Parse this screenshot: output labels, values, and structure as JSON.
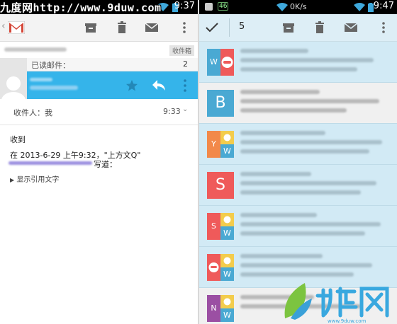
{
  "watermark": "九度网http://www.9duw.com",
  "left": {
    "status_time": "9:37",
    "folder_tag": "收件箱",
    "read_label": "已读邮件：",
    "read_count": "2",
    "to_label": "收件人：我",
    "time": "9:33",
    "body_greeting": "收到",
    "body_quote_line": "在 2013-6-29 上午9:32，\"上方文Q\"",
    "body_wrote": "写道：",
    "show_quoted": "显示引用文字"
  },
  "right": {
    "status_time": "9:47",
    "status_rate": "0K/s",
    "status_badge": "46",
    "selected_count": "5",
    "rows": [
      {
        "tile": "split-wf",
        "letters": [
          "W"
        ],
        "selected": true
      },
      {
        "tile": "single",
        "letters": [
          "B"
        ],
        "selected": false
      },
      {
        "tile": "quad",
        "letters": [
          "Y",
          "W"
        ],
        "selected": true
      },
      {
        "tile": "single",
        "letters": [
          "S"
        ],
        "selected": true
      },
      {
        "tile": "quad",
        "letters": [
          "S",
          "W"
        ],
        "selected": true
      },
      {
        "tile": "quad-face",
        "letters": [
          "W"
        ],
        "selected": true
      },
      {
        "tile": "quad",
        "letters": [
          "N",
          "W"
        ],
        "selected": false
      }
    ]
  },
  "logo_text": "www.9duw.com",
  "colors": {
    "accent_blue": "#35b4ea",
    "tile_blue": "#4aa9d3",
    "tile_orange": "#f2894a",
    "tile_red": "#ef5a5a",
    "tile_yellow": "#f3cc4c",
    "tile_purple": "#9b4fa3",
    "row_selected": "#d2eaf5"
  }
}
